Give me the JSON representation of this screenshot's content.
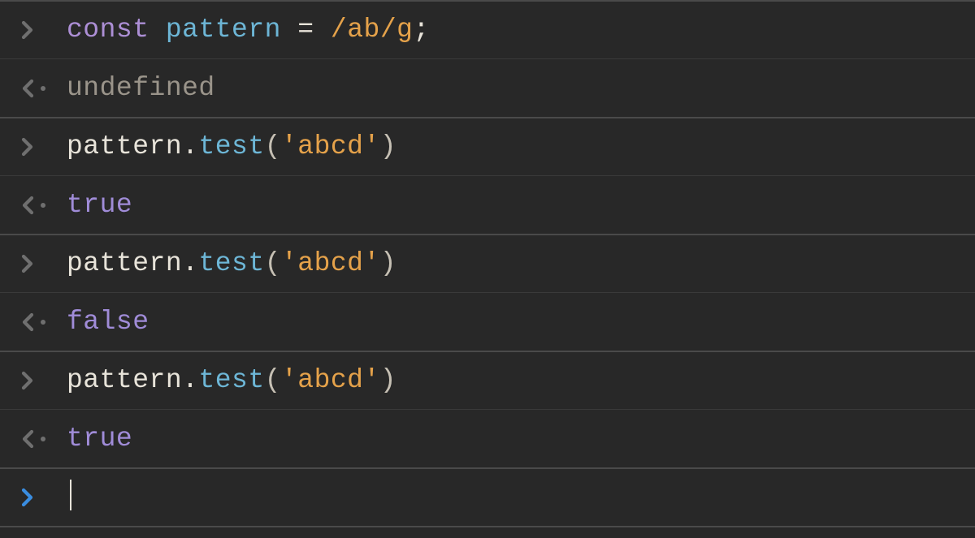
{
  "entries": [
    {
      "kind": "input",
      "tokens": [
        {
          "t": "const",
          "c": "tok-keyword"
        },
        {
          "t": " ",
          "c": "tok-default"
        },
        {
          "t": "pattern",
          "c": "tok-ident"
        },
        {
          "t": " ",
          "c": "tok-default"
        },
        {
          "t": "=",
          "c": "tok-op"
        },
        {
          "t": " ",
          "c": "tok-default"
        },
        {
          "t": "/ab/g",
          "c": "tok-regex"
        },
        {
          "t": ";",
          "c": "tok-op"
        }
      ]
    },
    {
      "kind": "output",
      "tokens": [
        {
          "t": "undefined",
          "c": "tok-undef"
        }
      ]
    },
    {
      "kind": "input",
      "tokens": [
        {
          "t": "pattern",
          "c": "tok-default"
        },
        {
          "t": ".",
          "c": "tok-op"
        },
        {
          "t": "test",
          "c": "tok-method"
        },
        {
          "t": "(",
          "c": "tok-paren"
        },
        {
          "t": "'abcd'",
          "c": "tok-string"
        },
        {
          "t": ")",
          "c": "tok-paren"
        }
      ]
    },
    {
      "kind": "output",
      "tokens": [
        {
          "t": "true",
          "c": "tok-bool"
        }
      ]
    },
    {
      "kind": "input",
      "tokens": [
        {
          "t": "pattern",
          "c": "tok-default"
        },
        {
          "t": ".",
          "c": "tok-op"
        },
        {
          "t": "test",
          "c": "tok-method"
        },
        {
          "t": "(",
          "c": "tok-paren"
        },
        {
          "t": "'abcd'",
          "c": "tok-string"
        },
        {
          "t": ")",
          "c": "tok-paren"
        }
      ]
    },
    {
      "kind": "output",
      "tokens": [
        {
          "t": "false",
          "c": "tok-bool"
        }
      ]
    },
    {
      "kind": "input",
      "tokens": [
        {
          "t": "pattern",
          "c": "tok-default"
        },
        {
          "t": ".",
          "c": "tok-op"
        },
        {
          "t": "test",
          "c": "tok-method"
        },
        {
          "t": "(",
          "c": "tok-paren"
        },
        {
          "t": "'abcd'",
          "c": "tok-string"
        },
        {
          "t": ")",
          "c": "tok-paren"
        }
      ]
    },
    {
      "kind": "output",
      "tokens": [
        {
          "t": "true",
          "c": "tok-bool"
        }
      ]
    }
  ],
  "prompt": {
    "active": true,
    "value": ""
  }
}
